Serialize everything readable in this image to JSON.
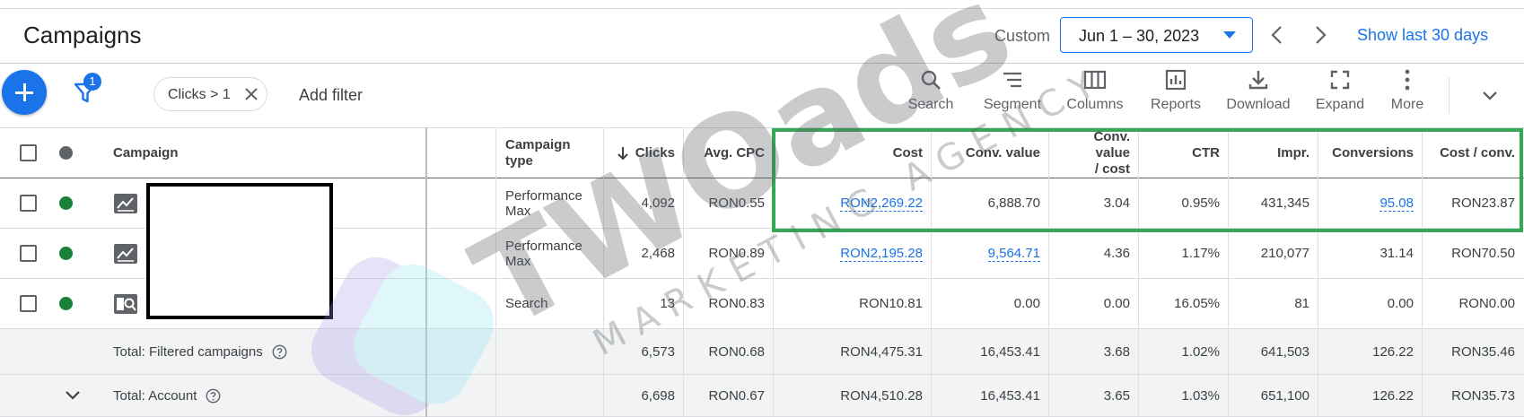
{
  "header": {
    "title": "Campaigns",
    "date_label": "Custom",
    "date_range": "Jun 1 – 30, 2023",
    "show_last": "Show last 30 days"
  },
  "toolbar": {
    "filter_count": "1",
    "filter_chip": "Clicks > 1",
    "add_filter": "Add filter",
    "tools": [
      {
        "label": "Search",
        "icon": "search-icon"
      },
      {
        "label": "Segment",
        "icon": "segment-icon"
      },
      {
        "label": "Columns",
        "icon": "columns-icon"
      },
      {
        "label": "Reports",
        "icon": "reports-icon"
      },
      {
        "label": "Download",
        "icon": "download-icon"
      },
      {
        "label": "Expand",
        "icon": "expand-icon"
      },
      {
        "label": "More",
        "icon": "more-vert-icon"
      }
    ]
  },
  "table": {
    "columns": {
      "campaign": "Campaign",
      "campaign_type_line1": "Campaign",
      "campaign_type_line2": "type",
      "clicks": "Clicks",
      "avg_cpc": "Avg. CPC",
      "cost": "Cost",
      "conv_value": "Conv. value",
      "conv_value_cost_line1": "Conv. value",
      "conv_value_cost_line2": "/ cost",
      "ctr": "CTR",
      "impr": "Impr.",
      "conversions": "Conversions",
      "cost_conv": "Cost / conv."
    },
    "rows": [
      {
        "status_color": "#188038",
        "icon": "performance-max-icon",
        "type_line1": "Performance",
        "type_line2": "Max",
        "clicks": "4,092",
        "avg_cpc": "RON0.55",
        "cost": "RON2,269.22",
        "conv_value": "6,888.70",
        "conv_value_cost": "3.04",
        "ctr": "0.95%",
        "impr": "431,345",
        "conversions": "95.08",
        "cost_conv": "RON23.87"
      },
      {
        "status_color": "#188038",
        "icon": "performance-max-icon",
        "type_line1": "Performance",
        "type_line2": "Max",
        "clicks": "2,468",
        "avg_cpc": "RON0.89",
        "cost": "RON2,195.28",
        "conv_value": "9,564.71",
        "conv_value_cost": "4.36",
        "ctr": "1.17%",
        "impr": "210,077",
        "conversions": "31.14",
        "cost_conv": "RON70.50"
      },
      {
        "status_color": "#188038",
        "icon": "search-campaign-icon",
        "type_line1": "Search",
        "type_line2": "",
        "clicks": "13",
        "avg_cpc": "RON0.83",
        "cost": "RON10.81",
        "conv_value": "0.00",
        "conv_value_cost": "0.00",
        "ctr": "16.05%",
        "impr": "81",
        "conversions": "0.00",
        "cost_conv": "RON0.00"
      }
    ],
    "totals": [
      {
        "label": "Total: Filtered campaigns",
        "clicks": "6,573",
        "avg_cpc": "RON0.68",
        "cost": "RON4,475.31",
        "conv_value": "16,453.41",
        "conv_value_cost": "3.68",
        "ctr": "1.02%",
        "impr": "641,503",
        "conversions": "126.22",
        "cost_conv": "RON35.46"
      },
      {
        "label": "Total: Account",
        "clicks": "6,698",
        "avg_cpc": "RON0.67",
        "cost": "RON4,510.28",
        "conv_value": "16,453.41",
        "conv_value_cost": "3.65",
        "ctr": "1.03%",
        "impr": "651,100",
        "conversions": "126.22",
        "cost_conv": "RON35.73"
      }
    ]
  },
  "watermark": {
    "brand": "TWOads",
    "tagline": "MARKETING AGENCY"
  },
  "colors": {
    "accent": "#1a73e8",
    "highlight": "#34a853",
    "status_enabled": "#188038"
  }
}
